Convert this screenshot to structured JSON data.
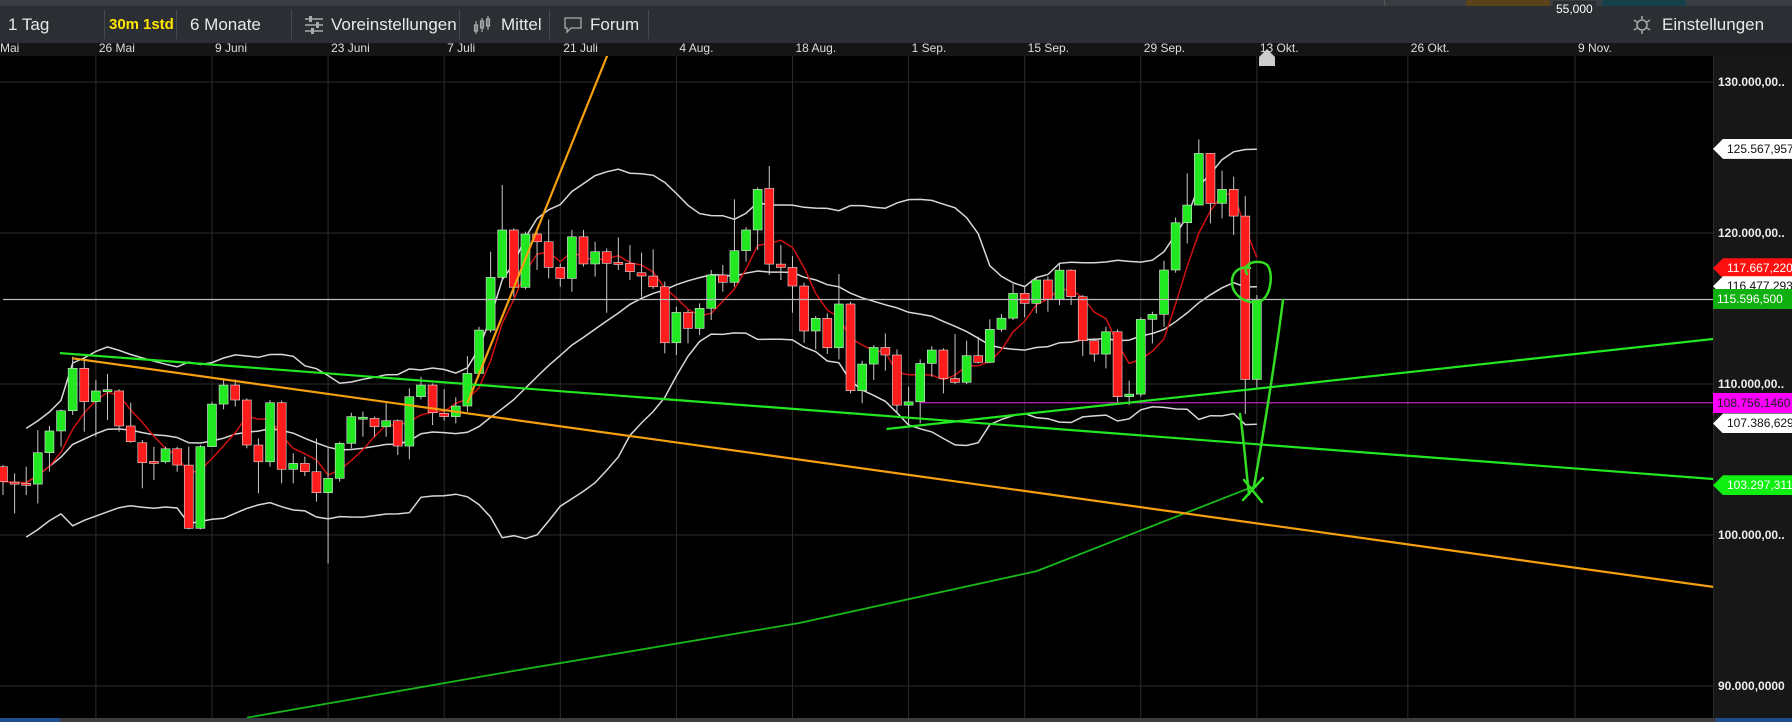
{
  "top_strip": {
    "partial_value": "55,000"
  },
  "toolbar": {
    "range_label": "1 Tag",
    "interval_30m": "30m",
    "interval_1std": "1std",
    "period_label": "6 Monate",
    "presets_label": "Voreinstellungen",
    "indicators_label": "Mittel",
    "forum_label": "Forum",
    "settings_label": "Einstellungen",
    "icons": {
      "presets": "sliders-icon",
      "indicators": "candlestick-icon",
      "forum": "speech-bubble-icon",
      "settings": "gear-icon"
    }
  },
  "colors": {
    "bull": "#22e822",
    "bear": "#ff1c1c",
    "bollinger": "#d8d8d8",
    "short_ma": "#d01010",
    "long_ma": "#18b818",
    "trend_orange": "#f5a010",
    "trend_green": "#22e822",
    "support_magenta": "#c020c0",
    "last_price_line": "#bbbbbb",
    "drawing_green": "#33dd22"
  },
  "chart_data": {
    "type": "candlestick",
    "x_ticks": [
      "Mai",
      "26 Mai",
      "9 Juni",
      "23 Juni",
      "7 Juli",
      "21 Juli",
      "4 Aug.",
      "18 Aug.",
      "1 Sep.",
      "15 Sep.",
      "29 Sep.",
      "13 Okt.",
      "26 Okt.",
      "9 Nov."
    ],
    "y_ticks": [
      {
        "value": 130000,
        "label": "130.000,00.."
      },
      {
        "value": 120000,
        "label": "120.000,00.."
      },
      {
        "value": 110000,
        "label": "110.000,00.."
      },
      {
        "value": 100000,
        "label": "100.000,00.."
      },
      {
        "value": 90000,
        "label": "90.000,0000"
      }
    ],
    "ylim": [
      86000,
      134000
    ],
    "grid": true,
    "candles_ohlc": [
      [
        104520,
        104630,
        102650,
        103530
      ],
      [
        103500,
        104080,
        101430,
        103450
      ],
      [
        103420,
        104520,
        102650,
        103400
      ],
      [
        103370,
        106950,
        102090,
        105450
      ],
      [
        105450,
        107220,
        104190,
        106890
      ],
      [
        106890,
        108320,
        105850,
        108230
      ],
      [
        108230,
        111810,
        107950,
        111040
      ],
      [
        111040,
        111700,
        106840,
        108830
      ],
      [
        108830,
        110260,
        106510,
        109540
      ],
      [
        109580,
        110660,
        107610,
        109620
      ],
      [
        109540,
        109650,
        106840,
        107220
      ],
      [
        107220,
        108760,
        106100,
        106180
      ],
      [
        106110,
        106290,
        103090,
        104790
      ],
      [
        104870,
        105850,
        103640,
        104850
      ],
      [
        104850,
        105850,
        104740,
        105710
      ],
      [
        105710,
        105850,
        104190,
        104630
      ],
      [
        104630,
        105850,
        100370,
        100440
      ],
      [
        100440,
        105960,
        100370,
        105850
      ],
      [
        105850,
        108830,
        105850,
        108670
      ],
      [
        108670,
        110370,
        108320,
        109930
      ],
      [
        109930,
        110310,
        108500,
        108940
      ],
      [
        108940,
        109050,
        105740,
        105960
      ],
      [
        105960,
        106400,
        102760,
        104850
      ],
      [
        104850,
        108940,
        104520,
        108760
      ],
      [
        108760,
        108900,
        103420,
        104350
      ],
      [
        104350,
        105410,
        103420,
        104740
      ],
      [
        104740,
        105190,
        103900,
        104190
      ],
      [
        104190,
        106400,
        102210,
        102800
      ],
      [
        102800,
        105850,
        98120,
        103750
      ],
      [
        103750,
        106180,
        103530,
        106070
      ],
      [
        106070,
        108100,
        105740,
        107840
      ],
      [
        107780,
        108170,
        106510,
        107800
      ],
      [
        107720,
        107840,
        106510,
        107170
      ],
      [
        107170,
        108720,
        106510,
        107570
      ],
      [
        107570,
        107660,
        105300,
        105890
      ],
      [
        105890,
        109710,
        105010,
        109160
      ],
      [
        109160,
        110480,
        108980,
        109930
      ],
      [
        109930,
        110040,
        107280,
        108100
      ],
      [
        108060,
        109650,
        107570,
        107840
      ],
      [
        107840,
        109120,
        107390,
        108540
      ],
      [
        108540,
        111850,
        108160,
        110700
      ],
      [
        110700,
        113790,
        110480,
        113570
      ],
      [
        113570,
        118760,
        113400,
        117060
      ],
      [
        117060,
        123180,
        116880,
        120200
      ],
      [
        120200,
        120310,
        115780,
        116400
      ],
      [
        116400,
        120090,
        116270,
        119930
      ],
      [
        119930,
        120090,
        117550,
        119420
      ],
      [
        119420,
        120900,
        116990,
        117720
      ],
      [
        117720,
        117990,
        116440,
        116990
      ],
      [
        116990,
        120200,
        116110,
        119750
      ],
      [
        119750,
        120200,
        117770,
        117950
      ],
      [
        117950,
        119420,
        117110,
        118760
      ],
      [
        118760,
        118980,
        114720,
        117990
      ],
      [
        118050,
        119710,
        117550,
        118030
      ],
      [
        117990,
        119200,
        116880,
        117440
      ],
      [
        117370,
        118700,
        115780,
        117150
      ],
      [
        117150,
        118920,
        116300,
        116440
      ],
      [
        116440,
        116780,
        112030,
        112730
      ],
      [
        112730,
        115120,
        111920,
        114740
      ],
      [
        114740,
        114900,
        112690,
        113680
      ],
      [
        113680,
        115340,
        113240,
        115010
      ],
      [
        115010,
        117550,
        114240,
        117220
      ],
      [
        117220,
        117880,
        116110,
        116730
      ],
      [
        116730,
        122230,
        116440,
        118830
      ],
      [
        118830,
        120370,
        118100,
        120200
      ],
      [
        120200,
        123020,
        118870,
        122890
      ],
      [
        122950,
        124440,
        117220,
        117940
      ],
      [
        117940,
        119200,
        116880,
        117720
      ],
      [
        117720,
        118470,
        114720,
        116490
      ],
      [
        116490,
        116710,
        112730,
        113510
      ],
      [
        113510,
        114500,
        112290,
        114350
      ],
      [
        114350,
        114680,
        111990,
        112400
      ],
      [
        112400,
        117280,
        111630,
        115300
      ],
      [
        115300,
        115450,
        109380,
        109560
      ],
      [
        109560,
        111540,
        108720,
        111320
      ],
      [
        111320,
        112580,
        110260,
        112420
      ],
      [
        112420,
        113350,
        110880,
        111920
      ],
      [
        111920,
        112290,
        108050,
        108600
      ],
      [
        108600,
        109820,
        107280,
        108820
      ],
      [
        108820,
        111630,
        107390,
        111360
      ],
      [
        111360,
        112510,
        110480,
        112250
      ],
      [
        112250,
        112360,
        109380,
        110370
      ],
      [
        110370,
        113310,
        109990,
        110110
      ],
      [
        110110,
        112870,
        109990,
        111880
      ],
      [
        111880,
        113130,
        111370,
        111430
      ],
      [
        111430,
        114280,
        111370,
        113620
      ],
      [
        113620,
        114630,
        113460,
        114360
      ],
      [
        114360,
        116620,
        114240,
        116000
      ],
      [
        116000,
        116400,
        114410,
        115340
      ],
      [
        115340,
        117110,
        114680,
        116890
      ],
      [
        116890,
        117110,
        114790,
        115600
      ],
      [
        115600,
        117990,
        115230,
        117540
      ],
      [
        117540,
        117590,
        115230,
        115780
      ],
      [
        115780,
        115890,
        111850,
        112870
      ],
      [
        112870,
        113020,
        111470,
        111980
      ],
      [
        111980,
        113790,
        111030,
        113460
      ],
      [
        113460,
        113620,
        108710,
        109160
      ],
      [
        109160,
        110220,
        108600,
        109330
      ],
      [
        109330,
        114410,
        109160,
        114280
      ],
      [
        114280,
        114790,
        112690,
        114610
      ],
      [
        114610,
        118160,
        113790,
        117550
      ],
      [
        117550,
        121030,
        117370,
        120680
      ],
      [
        120680,
        123950,
        119310,
        121850
      ],
      [
        121850,
        126200,
        121850,
        125270
      ],
      [
        125270,
        125270,
        120640,
        121960
      ],
      [
        121960,
        124130,
        120970,
        122890
      ],
      [
        122890,
        123730,
        119870,
        121120
      ],
      [
        121120,
        122450,
        108010,
        110300
      ],
      [
        110300,
        115890,
        109710,
        115596.5
      ]
    ],
    "indicators": {
      "bollinger": {
        "period": 20,
        "stddev": 2
      },
      "short_ma_period": 5,
      "long_ma": [
        [
          22,
          87900
        ],
        [
          45,
          91000
        ],
        [
          69.6,
          94170
        ],
        [
          90,
          97600
        ],
        [
          109,
          103297.311
        ]
      ]
    },
    "trend_lines": [
      {
        "color": "trend_orange",
        "from": [
          7,
          111700
        ],
        "to": [
          148.3,
          96560
        ]
      },
      {
        "color": "trend_orange",
        "from": [
          41,
          108740
        ],
        "to": [
          53.2,
          132050
        ]
      },
      {
        "color": "trend_green",
        "from": [
          5.9,
          112050
        ],
        "to": [
          148.3,
          103710
        ]
      },
      {
        "color": "trend_green",
        "from": [
          77.1,
          107020
        ],
        "to": [
          148.3,
          112980
        ]
      }
    ],
    "horizontal_lines": [
      {
        "color": "support_magenta",
        "value": 108756.146,
        "from_bar": 80
      },
      {
        "color": "last_price_line",
        "value": 115596.5,
        "from_bar": 1
      }
    ],
    "price_tags": [
      {
        "value": 125567.957,
        "label": "125.567,957",
        "bg": "#ffffff",
        "fg": "#111111",
        "shape": "arrow"
      },
      {
        "value": 117667.22,
        "label": "117.667,220",
        "bg": "#ff1010",
        "fg": "#ffffff",
        "shape": "arrow"
      },
      {
        "value": 116477.293,
        "label": "116.477,293",
        "bg": "#ffffff",
        "fg": "#111111",
        "shape": "arrow"
      },
      {
        "value": 115596.5,
        "label": "115.596,500",
        "bg": "#10b010",
        "fg": "#ffffff",
        "shape": "rect"
      },
      {
        "value": 108756.146,
        "label": "108.756,1460",
        "bg": "#ff00ff",
        "fg": "#222222",
        "shape": "rect"
      },
      {
        "value": 107386.629,
        "label": "107.386,629",
        "bg": "#ffffff",
        "fg": "#111111",
        "shape": "arrow"
      },
      {
        "value": 103297.311,
        "label": "103.297,311",
        "bg": "#11ee11",
        "fg": "#ffffff",
        "shape": "arrow"
      }
    ]
  }
}
